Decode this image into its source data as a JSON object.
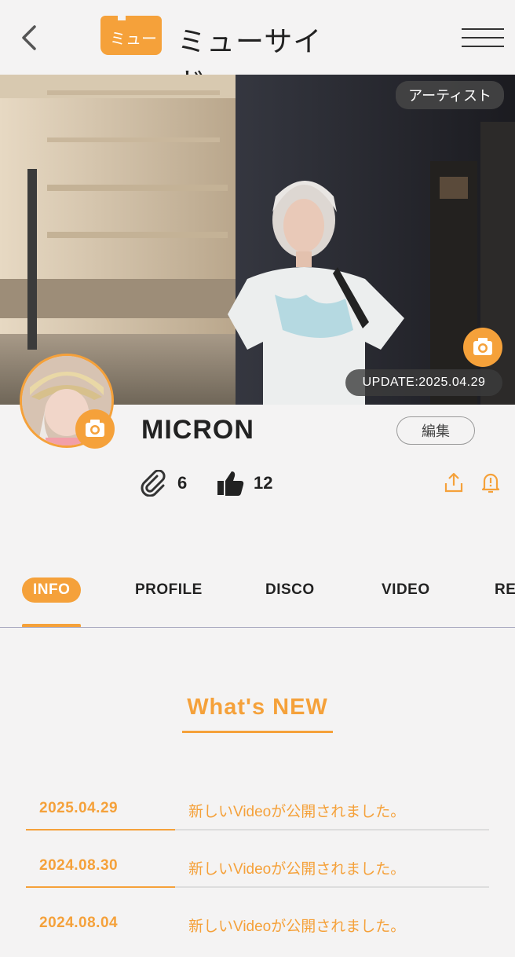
{
  "header": {
    "logo_mark_text": "ミュー",
    "logo_text": "ミューサイド"
  },
  "hero": {
    "badge": "アーティスト",
    "update": "UPDATE:2025.04.29"
  },
  "profile": {
    "name": "MICRON",
    "edit_label": "編集",
    "clips_count": "6",
    "likes_count": "12"
  },
  "tabs": [
    {
      "label": "INFO",
      "active": true
    },
    {
      "label": "PROFILE",
      "active": false
    },
    {
      "label": "DISCO",
      "active": false
    },
    {
      "label": "VIDEO",
      "active": false
    },
    {
      "label": "RE",
      "active": false
    }
  ],
  "whats_new": {
    "title": "What's NEW",
    "items": [
      {
        "date": "2025.04.29",
        "text": "新しいVideoが公開されました。"
      },
      {
        "date": "2024.08.30",
        "text": "新しいVideoが公開されました。"
      },
      {
        "date": "2024.08.04",
        "text": "新しいVideoが公開されました。"
      }
    ]
  },
  "icons": {
    "back": "chevron-left-icon",
    "menu": "hamburger-menu-icon",
    "camera": "camera-icon",
    "clip": "paperclip-icon",
    "like": "thumbs-up-icon",
    "share": "share-icon",
    "report": "alert-bell-icon"
  },
  "colors": {
    "accent": "#f5a13a",
    "background": "#f4f3f3",
    "text": "#222222"
  }
}
